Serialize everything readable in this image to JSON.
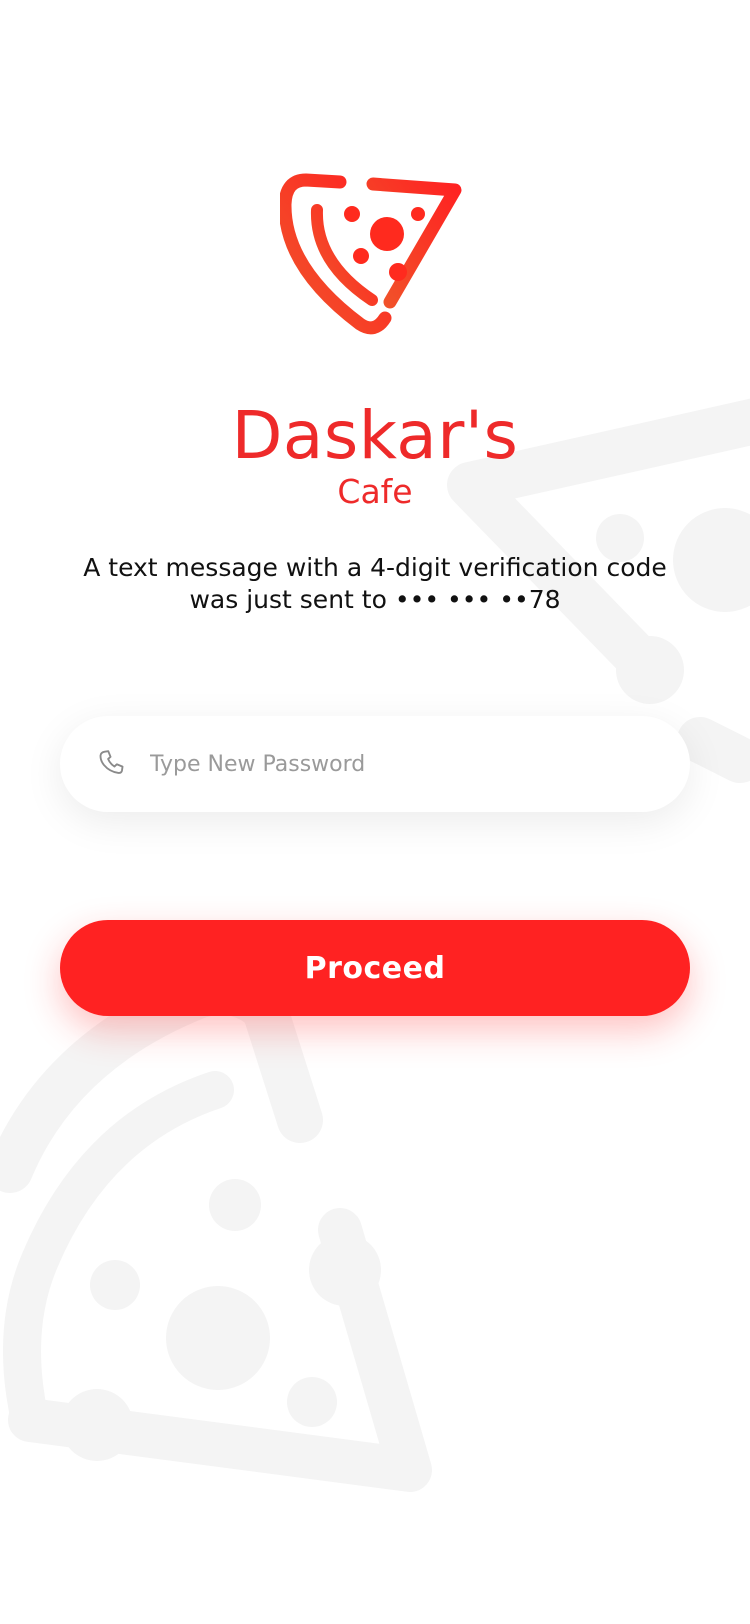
{
  "brand": {
    "name": "Daskar's",
    "subtitle": "Cafe",
    "accent_color": "#ee2a2a",
    "logo_icon": "pizza-slice-icon"
  },
  "verification": {
    "message_line1": "A text message with a 4-digit verification code",
    "message_line2": "was just sent to ••• ••• ••78"
  },
  "password_field": {
    "icon": "phone-icon",
    "placeholder": "Type New Password",
    "value": ""
  },
  "proceed_button": {
    "label": "Proceed",
    "color": "#ff2222"
  },
  "background": {
    "decoration_icon": "pizza-slice-watermark",
    "decoration_color": "#f5f5f5"
  }
}
